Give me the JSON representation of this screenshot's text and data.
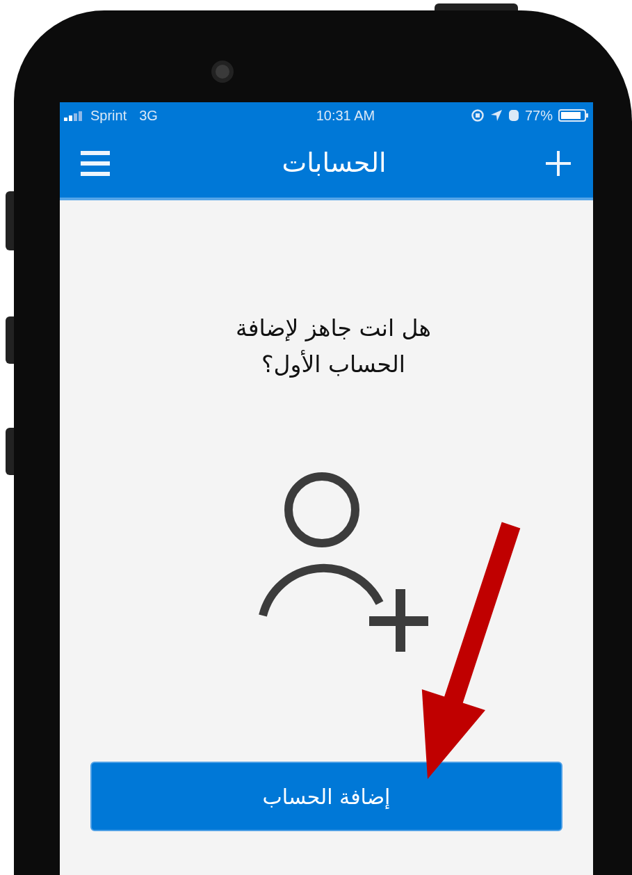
{
  "status_bar": {
    "carrier": "Sprint",
    "network": "3G",
    "time": "10:31 AM",
    "battery": "77%"
  },
  "nav_bar": {
    "title": "الحسابات"
  },
  "prompt": {
    "lines": [
      "هل انت جاهز لإضافة",
      "الحساب الأول؟"
    ]
  },
  "add_account_button": {
    "label": "إضافة الحساب"
  }
}
